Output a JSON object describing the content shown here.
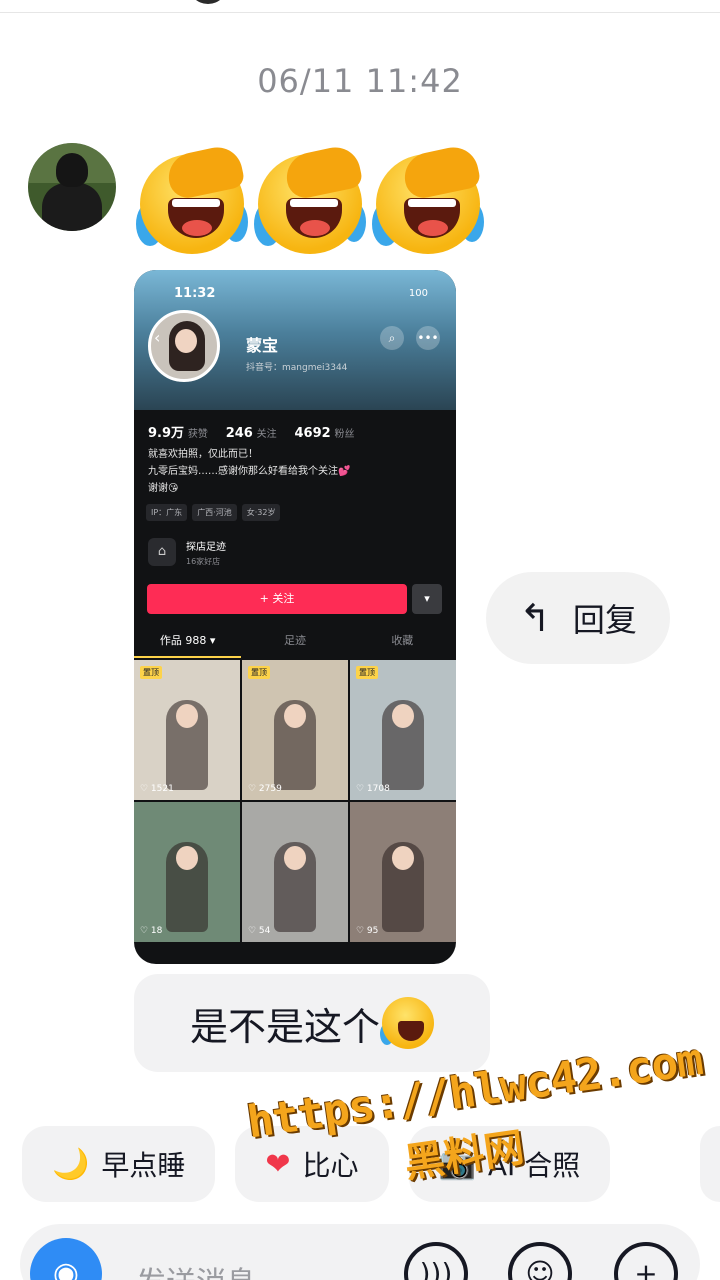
{
  "chat": {
    "timestamp": "06/11 11:42",
    "received_emojis": [
      "laughing-crying-emoji",
      "laughing-crying-emoji",
      "laughing-crying-emoji"
    ],
    "reply_action": {
      "label": "回复",
      "icon": "reply-arrow-icon"
    },
    "text_message": "是不是这个"
  },
  "shared_screenshot": {
    "status_time": "11:32",
    "status_battery": "100",
    "profile_name": "蒙宝",
    "uid_label": "抖音号：mangmei3344",
    "stats": [
      {
        "value": "9.9万",
        "label": "获赞"
      },
      {
        "value": "246",
        "label": "关注"
      },
      {
        "value": "4692",
        "label": "粉丝"
      }
    ],
    "bio_lines": [
      "就喜欢拍照，仅此而已！",
      "九零后宝妈……感谢你那么好看给我个关注💕",
      "谢谢😘"
    ],
    "tags": [
      "IP：广东",
      "广西·河池",
      "女·32岁"
    ],
    "shop_title": "探店足迹",
    "shop_sub": "16家好店",
    "follow_label": "+ 关注",
    "tabs": [
      {
        "label": "作品 988 ▾",
        "active": true
      },
      {
        "label": "足迹",
        "active": false
      },
      {
        "label": "收藏",
        "active": false
      }
    ],
    "grid": [
      {
        "pinned": "置顶",
        "likes": "♡ 1521",
        "bg": "#d9d2c6"
      },
      {
        "pinned": "置顶",
        "likes": "♡ 2759",
        "bg": "#cfc4b1"
      },
      {
        "pinned": "置顶",
        "likes": "♡ 1708",
        "bg": "#b7c1c4"
      },
      {
        "pinned": "",
        "likes": "♡ 18",
        "bg": "#6f8a76"
      },
      {
        "pinned": "",
        "likes": "♡ 54",
        "bg": "#a9a9a6"
      },
      {
        "pinned": "",
        "likes": "♡ 95",
        "bg": "#8d7f77"
      }
    ]
  },
  "quick_chips": [
    {
      "icon": "🌙",
      "label": "早点睡"
    },
    {
      "icon": "❤",
      "label": "比心"
    },
    {
      "icon": "📷",
      "label": "AI 合照"
    }
  ],
  "composer": {
    "placeholder": "发送消息"
  },
  "watermark": {
    "url": "https://hlwc42.com",
    "name": "黑料网"
  },
  "colors": {
    "accent_red": "#fe2c55",
    "camera_blue": "#2f8cf5",
    "watermark_orange": "#f4a51c"
  }
}
